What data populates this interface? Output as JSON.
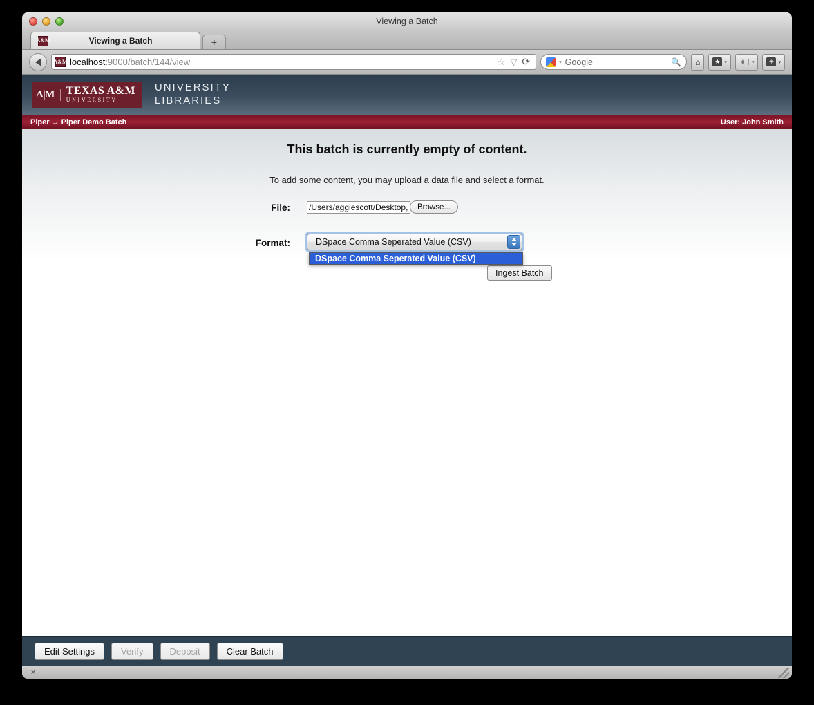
{
  "window": {
    "title": "Viewing a Batch",
    "traffic_lights": [
      "close",
      "minimize",
      "zoom"
    ]
  },
  "browser": {
    "tab": {
      "label": "Viewing a Batch",
      "favicon": "tamu-shield-icon"
    },
    "new_tab_label": "+",
    "back_label": "◀",
    "url": {
      "host": "localhost",
      "path": ":9000/batch/144/view",
      "full": "localhost:9000/batch/144/view"
    },
    "url_icons": {
      "bookmark_star": "☆",
      "dropdown_caret": "▽",
      "reload": "⟳"
    },
    "search": {
      "provider": "Google",
      "placeholder": "Google",
      "magnifier": "search-icon"
    },
    "toolbar_buttons": [
      {
        "name": "home-button",
        "glyph": "⌂"
      },
      {
        "name": "bookmarks-button",
        "glyph": "★",
        "caret": "▾"
      },
      {
        "name": "pin-button",
        "glyph": "✦",
        "caret": "▾"
      },
      {
        "name": "addons-button",
        "glyph": "✳",
        "caret": "▾"
      }
    ]
  },
  "site": {
    "logo": {
      "shield": "A|M",
      "line1": "TEXAS A&M",
      "line2": "UNIVERSITY"
    },
    "title_line1": "UNIVERSITY",
    "title_line2": "LIBRARIES",
    "breadcrumb": "Piper → Piper Demo Batch",
    "user": "User: John Smith",
    "colors": {
      "maroon": "#6d1f2c",
      "header_dark": "#2c3d4d",
      "header_light": "#5b6c7c",
      "footer": "#2f4352",
      "highlight_blue": "#2a5fd8"
    }
  },
  "main": {
    "heading": "This batch is currently empty of content.",
    "subheading": "To add some content, you may upload a data file and select a format.",
    "form": {
      "file": {
        "label": "File:",
        "value": "/Users/aggiescott/Desktop,",
        "browse_label": "Browse..."
      },
      "format": {
        "label": "Format:",
        "selected": "DSpace Comma Seperated Value (CSV)",
        "options": [
          "DSpace Comma Seperated Value (CSV)"
        ],
        "open": true
      },
      "submit_label": "Ingest Batch"
    }
  },
  "footer": {
    "buttons": [
      {
        "label": "Edit Settings",
        "name": "edit-settings-button",
        "disabled": false
      },
      {
        "label": "Verify",
        "name": "verify-button",
        "disabled": true
      },
      {
        "label": "Deposit",
        "name": "deposit-button",
        "disabled": true
      },
      {
        "label": "Clear Batch",
        "name": "clear-batch-button",
        "disabled": false
      }
    ]
  },
  "statusbar": {
    "close_glyph": "✕",
    "resize_grip": "resize-grip-icon"
  }
}
